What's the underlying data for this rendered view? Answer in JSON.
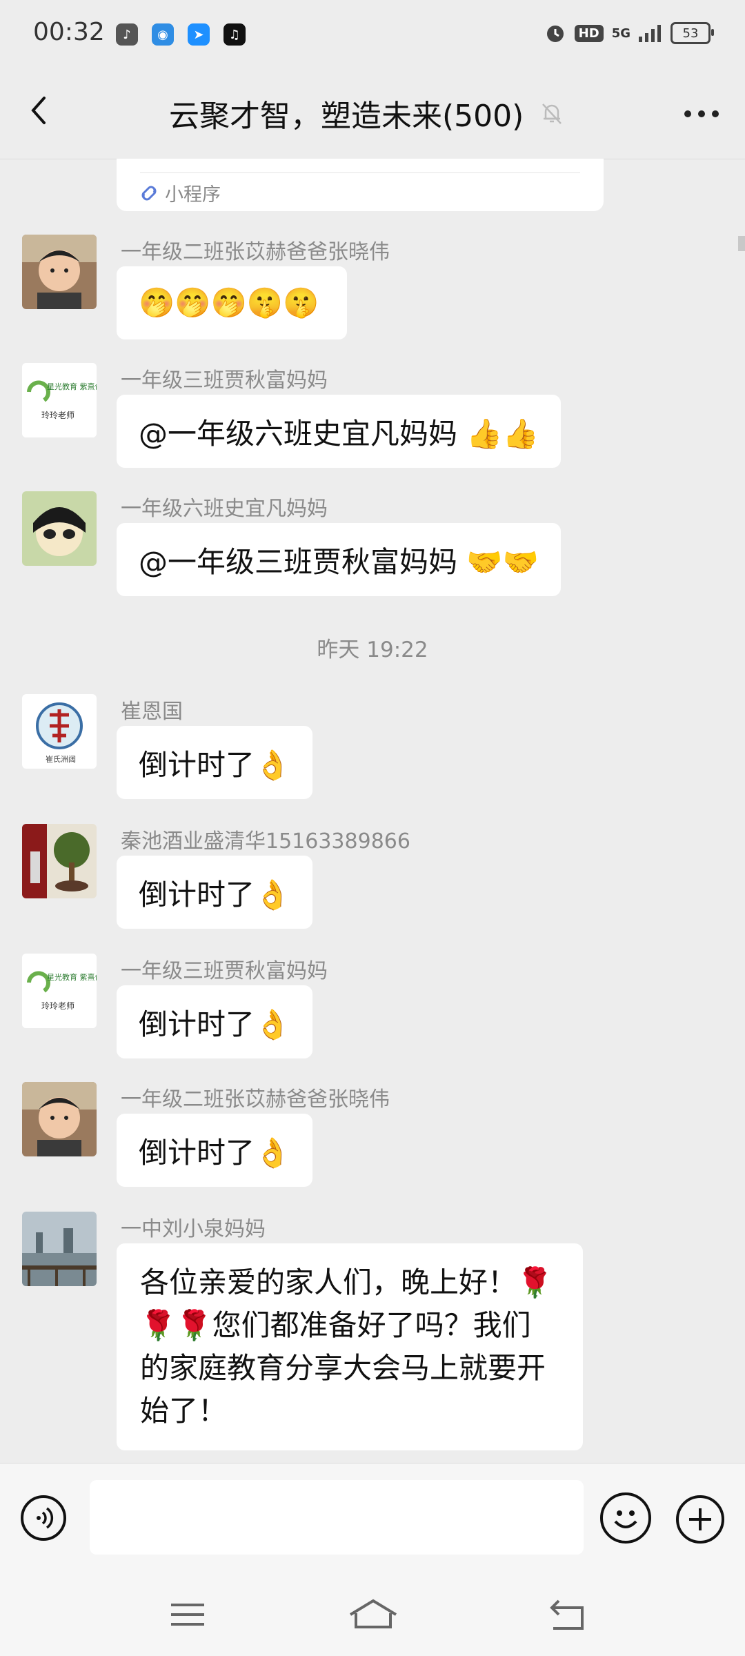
{
  "status_bar": {
    "time": "00:32",
    "hd": "HD",
    "network": "5G",
    "battery": "53"
  },
  "header": {
    "title": "云聚才智，塑造未来(500)"
  },
  "mini_program": {
    "label": "小程序"
  },
  "messages": [
    {
      "sender": "一年级二班张苡赫爸爸张晓伟",
      "text": "🤭🤭🤭🤫🤫"
    },
    {
      "sender": "一年级三班贾秋富妈妈",
      "text": "@一年级六班史宜凡妈妈 👍👍",
      "avatar_caption": "玲玲老师",
      "avatar_logo": "星光教育 紫熹创客"
    },
    {
      "sender": "一年级六班史宜凡妈妈",
      "text": "@一年级三班贾秋富妈妈 🤝🤝"
    },
    {
      "sender": "崔恩国",
      "text": "倒计时了👌",
      "avatar_caption": "崔氏洲阔"
    },
    {
      "sender": "秦池酒业盛清华15163389866",
      "text": "倒计时了👌"
    },
    {
      "sender": "一年级三班贾秋富妈妈",
      "text": "倒计时了👌",
      "avatar_caption": "玲玲老师",
      "avatar_logo": "星光教育 紫熹创客"
    },
    {
      "sender": "一年级二班张苡赫爸爸张晓伟",
      "text": "倒计时了👌"
    },
    {
      "sender": "一中刘小泉妈妈",
      "text": "各位亲爱的家人们，晚上好！🌹🌹🌹您们都准备好了吗？我们的家庭教育分享大会马上就要开始了！"
    }
  ],
  "timestamp": "昨天 19:22",
  "input": {
    "placeholder": ""
  },
  "icons": {
    "back": "chevron-left-icon",
    "mute": "bell-off-icon",
    "more": "more-dots-icon",
    "voice": "voice-icon",
    "emoji": "emoji-icon",
    "plus": "plus-icon",
    "nav_menu": "menu-icon",
    "nav_home": "home-icon",
    "nav_back": "back-icon"
  },
  "colors": {
    "background": "#ededed",
    "bubble": "#ffffff",
    "sender_text": "#8a8a8a"
  }
}
